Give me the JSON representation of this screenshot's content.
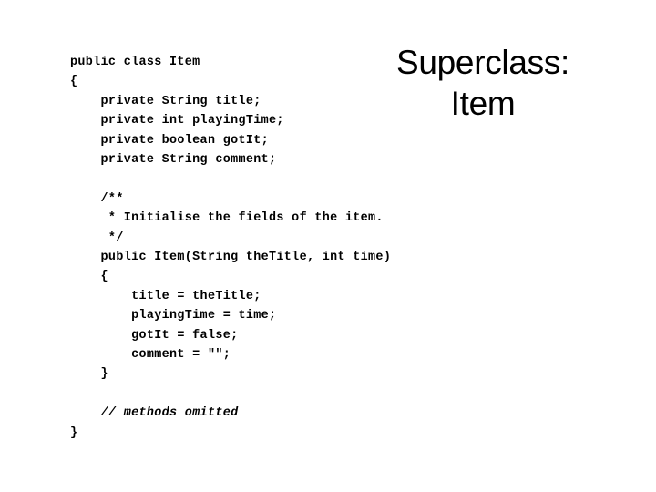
{
  "slide": {
    "background_color": "#ffffff",
    "text_color": "#000000"
  },
  "title": {
    "line1": "Superclass:",
    "line2": "Item"
  },
  "code": {
    "language": "java",
    "lines": [
      {
        "text": "public class Item",
        "style": "normal"
      },
      {
        "text": "{",
        "style": "normal"
      },
      {
        "text": "    private String title;",
        "style": "normal"
      },
      {
        "text": "    private int playingTime;",
        "style": "normal"
      },
      {
        "text": "    private boolean gotIt;",
        "style": "normal"
      },
      {
        "text": "    private String comment;",
        "style": "normal"
      },
      {
        "text": "",
        "style": "blank"
      },
      {
        "text": "    /**",
        "style": "normal"
      },
      {
        "text": "     * Initialise the fields of the item.",
        "style": "normal"
      },
      {
        "text": "     */",
        "style": "normal"
      },
      {
        "text": "    public Item(String theTitle, int time)",
        "style": "normal"
      },
      {
        "text": "    {",
        "style": "normal"
      },
      {
        "text": "        title = theTitle;",
        "style": "normal"
      },
      {
        "text": "        playingTime = time;",
        "style": "normal"
      },
      {
        "text": "        gotIt = false;",
        "style": "normal"
      },
      {
        "text": "        comment = \"\";",
        "style": "normal"
      },
      {
        "text": "    }",
        "style": "normal"
      },
      {
        "text": "",
        "style": "blank"
      },
      {
        "text": "    // methods omitted",
        "style": "italic"
      },
      {
        "text": "}",
        "style": "normal"
      }
    ]
  }
}
